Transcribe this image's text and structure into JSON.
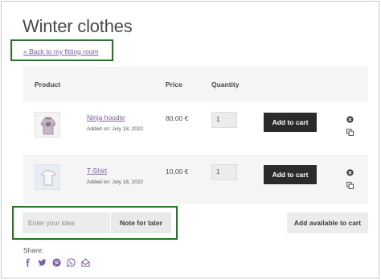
{
  "page": {
    "title": "Winter clothes",
    "back_link": "« Back to my fitting room"
  },
  "table": {
    "headers": {
      "product": "Product",
      "price": "Price",
      "quantity": "Quantity"
    },
    "rows": [
      {
        "name": "Ninja hoodie",
        "added": "Added on: July 18, 2022",
        "price": "80,00 €",
        "quantity": "1",
        "add_to_cart": "Add to cart",
        "thumb_icon": "hoodie-thumbnail"
      },
      {
        "name": "T-Shirt",
        "added": "Added on: July 18, 2022",
        "price": "10,00 €",
        "quantity": "1",
        "add_to_cart": "Add to cart",
        "thumb_icon": "tshirt-thumbnail"
      }
    ]
  },
  "note": {
    "placeholder": "Enter your idea",
    "button": "Note for later"
  },
  "add_all_button": "Add available to cart",
  "share": {
    "label": "Share:",
    "icons": [
      "facebook-icon",
      "twitter-icon",
      "pinterest-icon",
      "whatsapp-icon",
      "email-icon"
    ]
  },
  "colors": {
    "link": "#7b5ea7",
    "highlight": "#1f7a1f",
    "button_dark": "#2b2b2b",
    "share_icon": "#7b5ea7"
  }
}
